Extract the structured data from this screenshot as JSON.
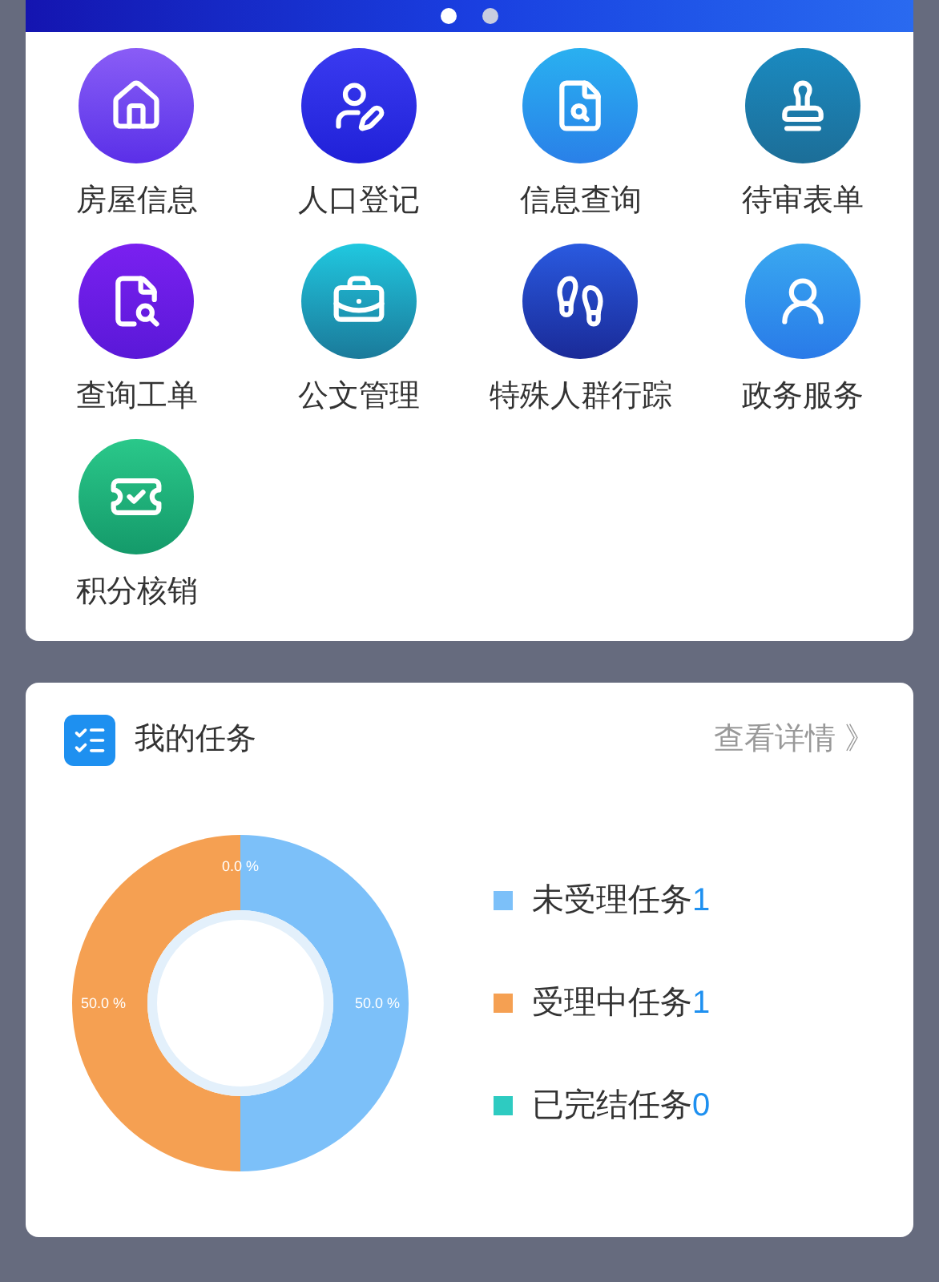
{
  "banner": {
    "pager": [
      {
        "selected": true
      },
      {
        "selected": false
      }
    ]
  },
  "menu": {
    "items": [
      {
        "label": "房屋信息"
      },
      {
        "label": "人口登记"
      },
      {
        "label": "信息查询"
      },
      {
        "label": "待审表单"
      },
      {
        "label": "查询工单"
      },
      {
        "label": "公文管理"
      },
      {
        "label": "特殊人群行踪"
      },
      {
        "label": "政务服务"
      },
      {
        "label": "积分核销"
      }
    ]
  },
  "tasks": {
    "title": "我的任务",
    "link": "查看详情 》",
    "legend": [
      {
        "count": "1",
        "color": "#7cc0f9"
      },
      {
        "count": "1",
        "color": "#f5a052"
      },
      {
        "count": "0",
        "color": "#2ecbc1"
      }
    ],
    "chart_data": {
      "type": "donut",
      "categories": [
        "未受理任务",
        "受理中任务",
        "已完结任务"
      ],
      "values": [
        50,
        50,
        0
      ],
      "value_labels": [
        "50.0 %",
        "50.0 %",
        "0.0 %"
      ]
    }
  }
}
